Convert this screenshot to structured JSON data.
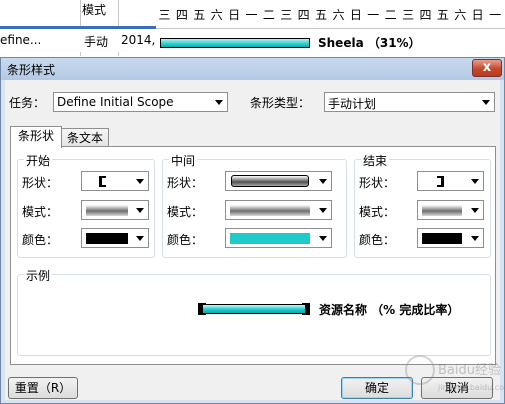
{
  "background": {
    "mode_header": "模式",
    "task_name": "efine...",
    "task_mode": "手动",
    "task_start": "2014,",
    "bar_label": "Sheela （31%）",
    "day_headers": [
      "三",
      "四",
      "五",
      "六",
      "日",
      "一",
      "二",
      "三",
      "四",
      "五",
      "六",
      "日",
      "一",
      "二",
      "三",
      "四",
      "五",
      "六",
      "日",
      "一"
    ],
    "bar_color": "#2dcece"
  },
  "dialog": {
    "title": "条形样式",
    "close_label": "x",
    "task_label": "任务：",
    "task_value": "Define Initial Scope",
    "bar_type_label": "条形类型：",
    "bar_type_value": "手动计划",
    "tabs": [
      "条形状",
      "条文本"
    ],
    "groups": {
      "start": {
        "title": "开始",
        "shape_label": "形状：",
        "pattern_label": "模式：",
        "color_label": "颜色：",
        "color": "#000000"
      },
      "middle": {
        "title": "中间",
        "shape_label": "形状：",
        "pattern_label": "模式：",
        "color_label": "颜色：",
        "color": "#1ecbcb"
      },
      "end": {
        "title": "结束",
        "shape_label": "形状：",
        "pattern_label": "模式：",
        "color_label": "颜色：",
        "color": "#000000"
      }
    },
    "sample": {
      "title": "示例",
      "label": "资源名称 （% 完成比率）"
    },
    "reset_button": "重置（R）",
    "ok_button": "确定",
    "cancel_button": "取消"
  },
  "watermark": {
    "text": "Baidu经验",
    "sub": "jingyan.baidu.com"
  }
}
